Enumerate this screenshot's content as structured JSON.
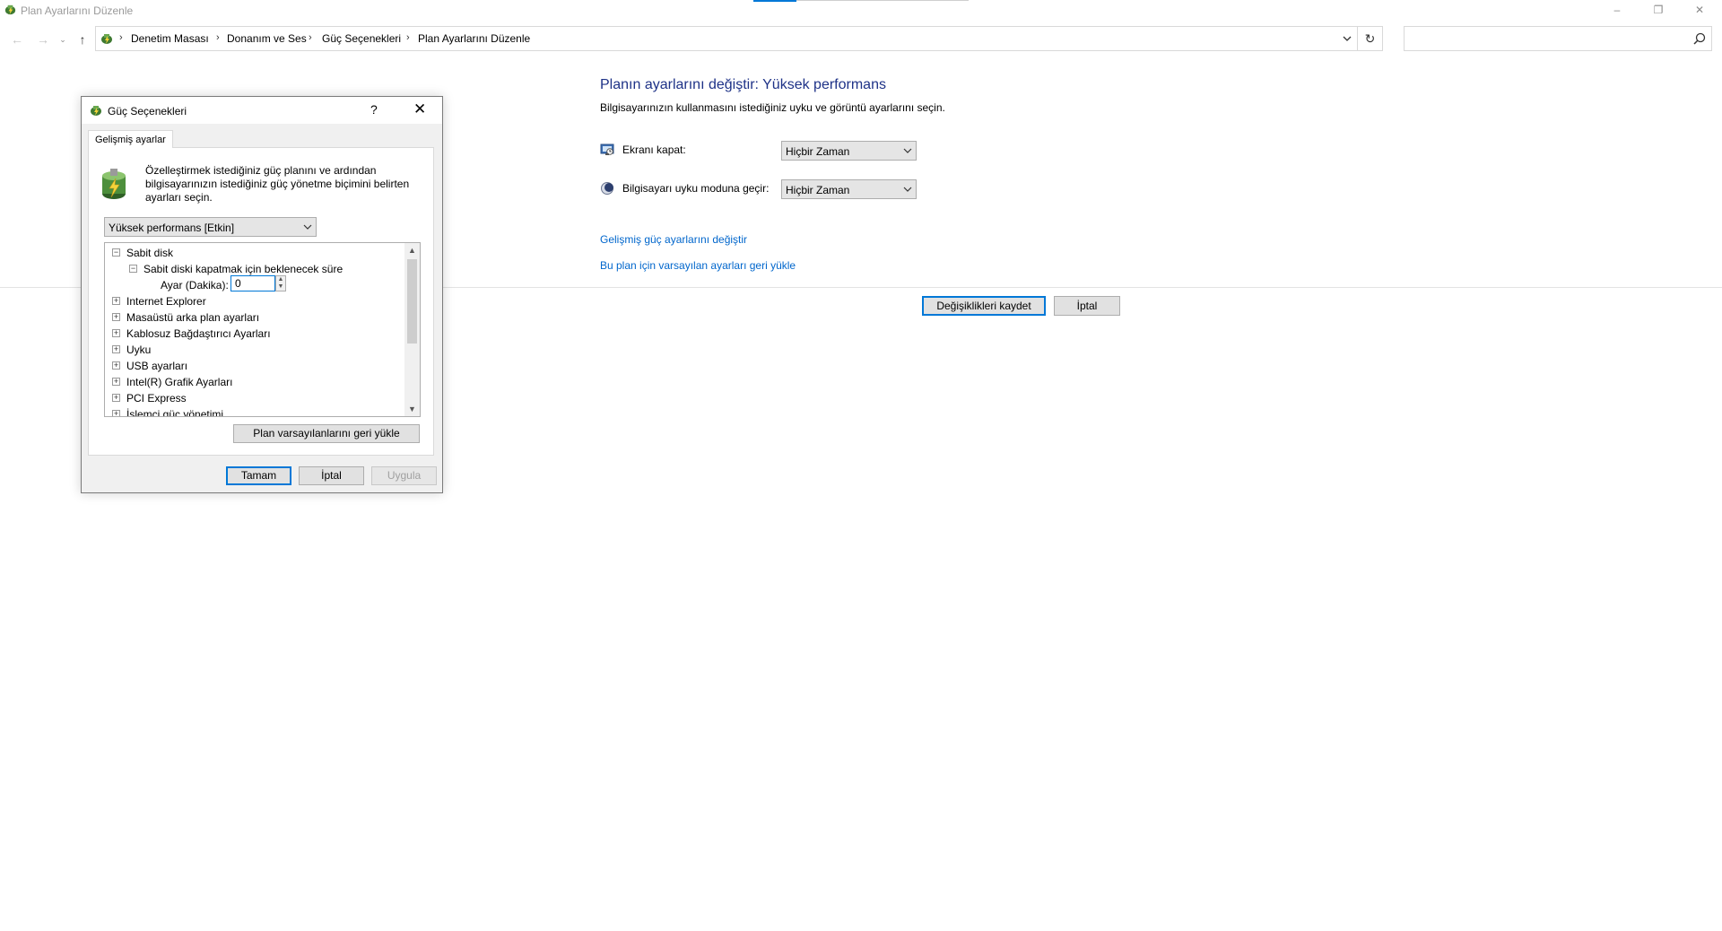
{
  "window": {
    "title": "Plan Ayarlarını Düzenle",
    "controls": {
      "minimize": "–",
      "maximize": "❐",
      "close": "✕"
    }
  },
  "nav": {
    "back_icon": "←",
    "forward_icon": "→",
    "recent_icon": "⌄",
    "up_icon": "↑",
    "breadcrumbs": [
      "Denetim Masası",
      "Donanım ve Ses",
      "Güç Seçenekleri",
      "Plan Ayarlarını Düzenle"
    ],
    "breadcrumb_sep": "›",
    "refresh_icon": "↻",
    "search_placeholder": ""
  },
  "main": {
    "title": "Planın ayarlarını değiştir: Yüksek performans",
    "subtitle": "Bilgisayarınızın kullanmasını istediğiniz uyku ve görüntü ayarlarını seçin.",
    "settings": [
      {
        "label": "Ekranı kapat:",
        "value": "Hiçbir Zaman",
        "icon": "monitor-icon"
      },
      {
        "label": "Bilgisayarı uyku moduna geçir:",
        "value": "Hiçbir Zaman",
        "icon": "moon-icon"
      }
    ],
    "links": [
      "Gelişmiş güç ayarlarını değiştir",
      "Bu plan için varsayılan ayarları geri yükle"
    ],
    "save_button": "Değişiklikleri kaydet",
    "cancel_button": "İptal"
  },
  "dialog": {
    "title": "Güç Seçenekleri",
    "help": "?",
    "close": "✕",
    "tab": "Gelişmiş ayarlar",
    "intro": "Özelleştirmek istediğiniz güç planını ve ardından bilgisayarınızın istediğiniz güç yönetme biçimini belirten ayarları seçin.",
    "plan_value": "Yüksek performans [Etkin]",
    "tree": {
      "items": [
        {
          "label": "Sabit disk",
          "expander": "−"
        },
        {
          "label": "Sabit diski kapatmak için beklenecek süre",
          "expander": "−"
        },
        {
          "label": "Ayar (Dakika):",
          "value": "0"
        },
        {
          "label": "Internet Explorer",
          "expander": "+"
        },
        {
          "label": "Masaüstü arka plan ayarları",
          "expander": "+"
        },
        {
          "label": "Kablosuz Bağdaştırıcı Ayarları",
          "expander": "+"
        },
        {
          "label": "Uyku",
          "expander": "+"
        },
        {
          "label": "USB ayarları",
          "expander": "+"
        },
        {
          "label": "Intel(R) Grafik Ayarları",
          "expander": "+"
        },
        {
          "label": "PCI Express",
          "expander": "+"
        },
        {
          "label": "İşlemci güç yönetimi",
          "expander": "+"
        }
      ],
      "spin_up": "▲",
      "spin_down": "▼",
      "scroll_up": "▲",
      "scroll_down": "▼"
    },
    "restore_button": "Plan varsayılanlarını geri yükle",
    "ok_button": "Tamam",
    "cancel_button": "İptal",
    "apply_button": "Uygula"
  }
}
